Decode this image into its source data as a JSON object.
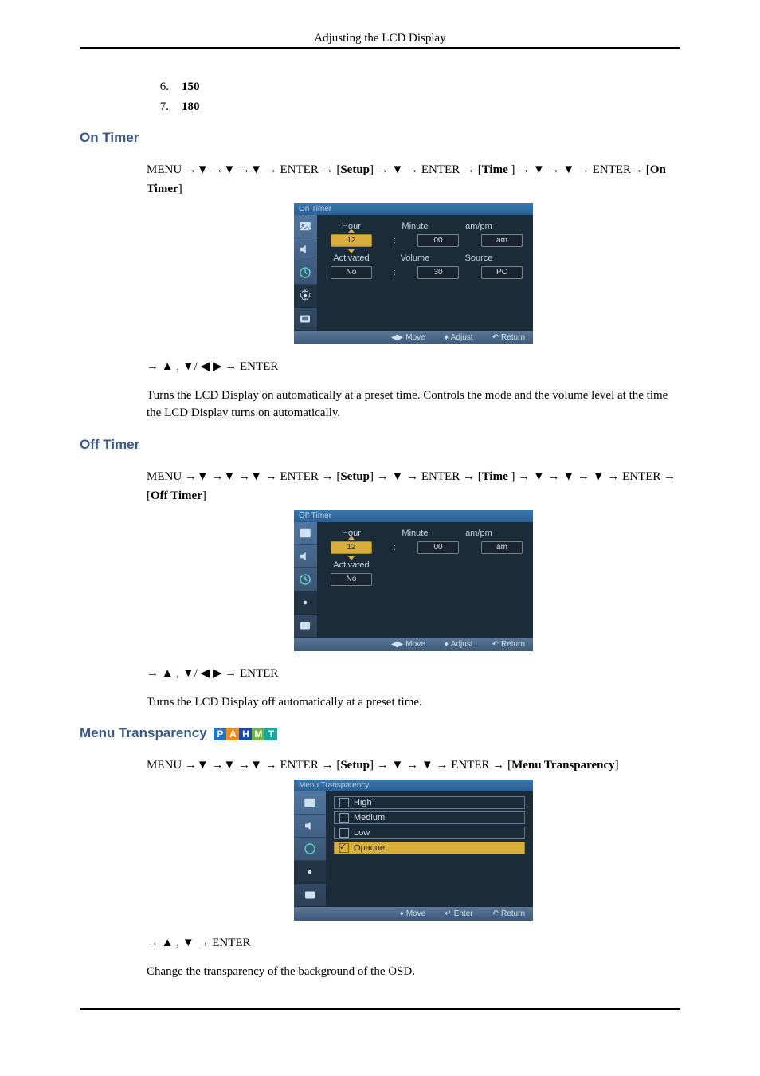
{
  "header": "Adjusting the LCD Display",
  "list": [
    {
      "n": "6.",
      "v": "150"
    },
    {
      "n": "7.",
      "v": "180"
    }
  ],
  "s1": {
    "title": "On Timer",
    "path_parts": [
      "MENU →",
      " →",
      " →",
      " → ENTER → [",
      "Setup",
      "] →",
      " → ENTER → [",
      "Time",
      " ] →",
      " →",
      " → ENTER→ [",
      "On Timer",
      "]"
    ],
    "osd": {
      "title": "On Timer",
      "labels": {
        "hour": "Hour",
        "minute": "Minute",
        "ampm": "am/pm",
        "activated": "Activated",
        "volume": "Volume",
        "source": "Source"
      },
      "vals": {
        "hour": "12",
        "minute": "00",
        "ampm": "am",
        "activated": "No",
        "volume": "30",
        "source": "PC"
      },
      "foot": {
        "move": "Move",
        "adjust": "Adjust",
        "return": "Return"
      }
    },
    "post": "→  ,  /   → ENTER",
    "para": "Turns the LCD Display on automatically at a preset time. Controls the mode and the volume level at the time the LCD Display turns on automatically."
  },
  "s2": {
    "title": "Off Timer",
    "path_parts": [
      "MENU →",
      " →",
      " →",
      " → ENTER → [",
      "Setup",
      "] →",
      " → ENTER → [",
      "Time",
      " ] →",
      " →",
      " →",
      " → ENTER → [",
      "Off Timer",
      "]"
    ],
    "osd": {
      "title": "Off Timer",
      "labels": {
        "hour": "Hour",
        "minute": "Minute",
        "ampm": "am/pm",
        "activated": "Activated"
      },
      "vals": {
        "hour": "12",
        "minute": "00",
        "ampm": "am",
        "activated": "No"
      },
      "foot": {
        "move": "Move",
        "adjust": "Adjust",
        "return": "Return"
      }
    },
    "post": "→  ,  /   → ENTER",
    "para": "Turns the LCD Display off automatically at a preset time."
  },
  "s3": {
    "title": "Menu Transparency",
    "badges": [
      "P",
      "A",
      "H",
      "M",
      "T"
    ],
    "badge_colors": [
      "#1f74c3",
      "#f08a1a",
      "#1a4aa0",
      "#6fb34a",
      "#1aa6a0"
    ],
    "path_parts": [
      "MENU →",
      " →",
      " →",
      " → ENTER → [",
      "Setup",
      "] →",
      " →",
      " → ENTER → [",
      "Menu Transparency",
      "]"
    ],
    "osd": {
      "title": "Menu Transparency",
      "opts": [
        "High",
        "Medium",
        "Low",
        "Opaque"
      ],
      "sel": 3,
      "foot": {
        "move": "Move",
        "enter": "Enter",
        "return": "Return"
      }
    },
    "post": "→  ,  → ENTER",
    "para": "Change the transparency of the background of the OSD."
  }
}
